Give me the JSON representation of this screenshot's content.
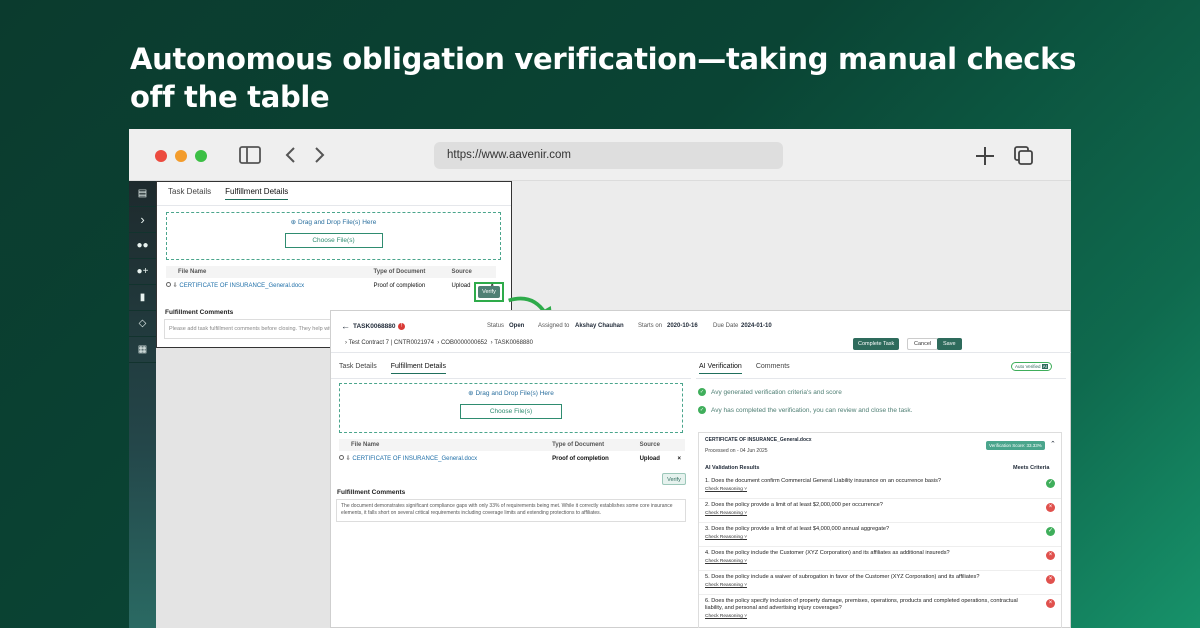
{
  "headline": "Autonomous obligation verification—taking manual checks off the table",
  "browser": {
    "url": "https://www.aavenir.com",
    "icons": [
      "sidebar-toggle-icon",
      "back-icon",
      "forward-icon",
      "new-tab-icon",
      "duplicate-icon"
    ]
  },
  "sidebar": {
    "icons": [
      "menu-icon",
      "chevron-right-icon",
      "users-icon",
      "add-user-icon",
      "book-icon",
      "code-icon",
      "grid-icon"
    ]
  },
  "back_card": {
    "tabs": [
      "Task Details",
      "Fulfillment Details"
    ],
    "drop_text": "Drag and Drop File(s) Here",
    "choose_label": "Choose File(s)",
    "columns": [
      "File Name",
      "Type of Document",
      "Source"
    ],
    "row": {
      "file": "CERTIFICATE OF INSURANCE_General.docx",
      "type": "Proof of completion",
      "source": "Upload",
      "remove": "×"
    },
    "verify_label": "Verify",
    "comments_label": "Fulfillment Comments",
    "comments_placeholder": "Please add task fulfillment comments before closing. They help with"
  },
  "front_card": {
    "header": {
      "task_id": "TASK0068880",
      "status_label": "Status",
      "status_value": "Open",
      "assigned_label": "Assigned to",
      "assigned_value": "Akshay Chauhan",
      "starts_label": "Starts on",
      "starts_value": "2020-10-16",
      "due_label": "Due Date",
      "due_value": "2024-01-10",
      "breadcrumbs": [
        "Test Contract 7 | CNTR0021974",
        "COB0000000652",
        "TASK0068880"
      ],
      "complete_label": "Complete Task",
      "cancel_label": "Cancel",
      "save_label": "Save"
    },
    "left": {
      "tabs": [
        "Task Details",
        "Fulfillment Details"
      ],
      "drop_text": "Drag and Drop File(s) Here",
      "choose_label": "Choose File(s)",
      "columns": [
        "File Name",
        "Type of Document",
        "Source"
      ],
      "row": {
        "file": "CERTIFICATE OF INSURANCE_General.docx",
        "type": "Proof of completion",
        "source": "Upload",
        "remove": "×"
      },
      "verify_label": "Verify",
      "comments_label": "Fulfillment Comments",
      "comments_text": "The document demonstrates significant compliance gaps with only 33% of requirements being met. While it correctly establishes some core insurance elements, it falls short on several critical requirements including coverage limits and extending protections to affiliates."
    },
    "right": {
      "tabs": [
        "AI Verification",
        "Comments"
      ],
      "auto_verified_label": "Auto Verified",
      "auto_verified_badge": "AI",
      "info": [
        "Avy generated verification criteria's and score",
        "Avy has completed the verification, you can review and close the task."
      ],
      "doc_name": "CERTIFICATE OF INSURANCE_General.docx",
      "processed": "Processed on - 04 Jun 2025",
      "score_label": "Verification Score: 33.33%",
      "results_label": "AI Validation Results",
      "meets_label": "Meets Criteria",
      "reasoning_label": "Check Reasoning",
      "questions": [
        {
          "text": "1. Does the document confirm Commercial General Liability insurance on an occurrence basis?",
          "ok": true
        },
        {
          "text": "2. Does the policy provide a limit of at least $2,000,000 per occurrence?",
          "ok": false
        },
        {
          "text": "3. Does the policy provide a limit of at least $4,000,000 annual aggregate?",
          "ok": true
        },
        {
          "text": "4. Does the policy include the Customer (XYZ Corporation) and its affiliates as additional insureds?",
          "ok": false
        },
        {
          "text": "5. Does the policy include a waiver of subrogation in favor of the Customer (XYZ Corporation) and its affiliates?",
          "ok": false
        },
        {
          "text": "6. Does the policy specify inclusion of property damage, premises, operations, products and completed operations, contractual liability, and personal and advertising injury coverages?",
          "ok": false
        }
      ]
    }
  }
}
